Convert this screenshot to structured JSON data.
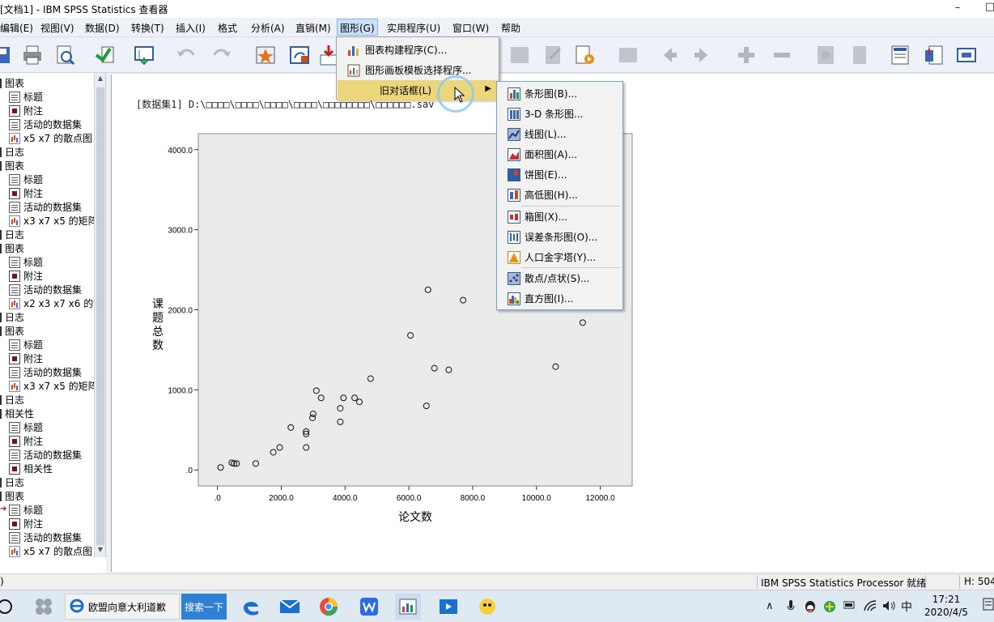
{
  "window": {
    "title": "[文档1] - IBM SPSS Statistics 查看器",
    "minimize_label": "–",
    "close_label": "□"
  },
  "menubar": {
    "items": [
      {
        "label": "编辑(E)"
      },
      {
        "label": "视图(V)"
      },
      {
        "label": "数据(D)"
      },
      {
        "label": "转换(T)"
      },
      {
        "label": "插入(I)"
      },
      {
        "label": "格式"
      },
      {
        "label": "分析(A)"
      },
      {
        "label": "直销(M)"
      },
      {
        "label": "图形(G)"
      },
      {
        "label": "实用程序(U)"
      },
      {
        "label": "窗口(W)"
      },
      {
        "label": "帮助"
      }
    ],
    "active": "图形(G)"
  },
  "graph_menu": {
    "items": [
      {
        "label": "图表构建程序(C)..."
      },
      {
        "label": "图形画板模板选择程序..."
      },
      {
        "label": "旧对话框(L)"
      }
    ],
    "highlighted": "旧对话框(L)"
  },
  "legacy_submenu": {
    "items": [
      {
        "label": "条形图(B)..."
      },
      {
        "label": "3-D 条形图..."
      },
      {
        "label": "线图(L)..."
      },
      {
        "label": "面积图(A)..."
      },
      {
        "label": "饼图(E)..."
      },
      {
        "label": "高低图(H)..."
      },
      {
        "label": "箱图(X)..."
      },
      {
        "label": "误差条形图(O)..."
      },
      {
        "label": "人口金字塔(Y)..."
      },
      {
        "label": "散点/点状(S)..."
      },
      {
        "label": "直方图(I)..."
      }
    ]
  },
  "nav_tree": {
    "rows": [
      {
        "label": "图表",
        "level": 0,
        "icon": "none"
      },
      {
        "label": "标题",
        "level": 1,
        "icon": "title-icon"
      },
      {
        "label": "附注",
        "level": 1,
        "icon": "notes-icon"
      },
      {
        "label": "活动的数据集",
        "level": 1,
        "icon": "dataset-icon"
      },
      {
        "label": "x5 x7 的散点图",
        "level": 1,
        "icon": "chart-icon"
      },
      {
        "label": "日志",
        "level": 0,
        "icon": "none"
      },
      {
        "label": "图表",
        "level": 0,
        "icon": "none"
      },
      {
        "label": "标题",
        "level": 1,
        "icon": "title-icon"
      },
      {
        "label": "附注",
        "level": 1,
        "icon": "notes-icon"
      },
      {
        "label": "活动的数据集",
        "level": 1,
        "icon": "dataset-icon"
      },
      {
        "label": "x3 x7 x5 的矩阵",
        "level": 1,
        "icon": "chart-icon"
      },
      {
        "label": "日志",
        "level": 0,
        "icon": "none"
      },
      {
        "label": "图表",
        "level": 0,
        "icon": "none"
      },
      {
        "label": "标题",
        "level": 1,
        "icon": "title-icon"
      },
      {
        "label": "附注",
        "level": 1,
        "icon": "notes-icon"
      },
      {
        "label": "活动的数据集",
        "level": 1,
        "icon": "dataset-icon"
      },
      {
        "label": "x2 x3 x7 x6 的散",
        "level": 1,
        "icon": "chart-icon"
      },
      {
        "label": "日志",
        "level": 0,
        "icon": "none"
      },
      {
        "label": "图表",
        "level": 0,
        "icon": "none"
      },
      {
        "label": "标题",
        "level": 1,
        "icon": "title-icon"
      },
      {
        "label": "附注",
        "level": 1,
        "icon": "notes-icon"
      },
      {
        "label": "活动的数据集",
        "level": 1,
        "icon": "dataset-icon"
      },
      {
        "label": "x3 x7 x5 的矩阵",
        "level": 1,
        "icon": "chart-icon"
      },
      {
        "label": "日志",
        "level": 0,
        "icon": "none"
      },
      {
        "label": "相关性",
        "level": 0,
        "icon": "none"
      },
      {
        "label": "标题",
        "level": 1,
        "icon": "title-icon"
      },
      {
        "label": "附注",
        "level": 1,
        "icon": "notes-icon"
      },
      {
        "label": "活动的数据集",
        "level": 1,
        "icon": "dataset-icon"
      },
      {
        "label": "相关性",
        "level": 1,
        "icon": "table-icon"
      },
      {
        "label": "日志",
        "level": 0,
        "icon": "none"
      },
      {
        "label": "图表",
        "level": 0,
        "icon": "none"
      },
      {
        "label": "标题",
        "level": 1,
        "icon": "title-icon",
        "selected": true
      },
      {
        "label": "附注",
        "level": 1,
        "icon": "notes-icon"
      },
      {
        "label": "活动的数据集",
        "level": 1,
        "icon": "dataset-icon"
      },
      {
        "label": "x5 x7 的散点图",
        "level": 1,
        "icon": "chart-icon"
      }
    ]
  },
  "output": {
    "file_path": "[数据集1] D:\\□□□□\\□□□□\\□□□□\\□□□□\\□□□□□□□□\\□□□□□□.sav"
  },
  "chart_data": {
    "type": "scatter",
    "title": "",
    "xlabel": "论文数",
    "ylabel": "课题总数",
    "xlim": [
      -600,
      13000
    ],
    "ylim": [
      -200,
      4200
    ],
    "x_ticks": [
      ".0",
      "2000.0",
      "4000.0",
      "6000.0",
      "8000.0",
      "10000.0",
      "12000.0"
    ],
    "x_tick_values": [
      0,
      2000,
      4000,
      6000,
      8000,
      10000,
      12000
    ],
    "y_ticks": [
      ".0",
      "1000.0",
      "2000.0",
      "3000.0",
      "4000.0"
    ],
    "y_tick_values": [
      0,
      1000,
      2000,
      3000,
      4000
    ],
    "marker": "open-circle",
    "plot_background": "#ebebeb",
    "points": [
      {
        "x": 100,
        "y": 30
      },
      {
        "x": 450,
        "y": 90
      },
      {
        "x": 520,
        "y": 80
      },
      {
        "x": 600,
        "y": 80
      },
      {
        "x": 1200,
        "y": 80
      },
      {
        "x": 1750,
        "y": 220
      },
      {
        "x": 1950,
        "y": 280
      },
      {
        "x": 2300,
        "y": 530
      },
      {
        "x": 2780,
        "y": 280
      },
      {
        "x": 2780,
        "y": 450
      },
      {
        "x": 2780,
        "y": 480
      },
      {
        "x": 2980,
        "y": 650
      },
      {
        "x": 3000,
        "y": 700
      },
      {
        "x": 3100,
        "y": 990
      },
      {
        "x": 3250,
        "y": 900
      },
      {
        "x": 3850,
        "y": 600
      },
      {
        "x": 3850,
        "y": 770
      },
      {
        "x": 3950,
        "y": 900
      },
      {
        "x": 4300,
        "y": 900
      },
      {
        "x": 4450,
        "y": 850
      },
      {
        "x": 4800,
        "y": 1140
      },
      {
        "x": 6050,
        "y": 1680
      },
      {
        "x": 6550,
        "y": 800
      },
      {
        "x": 6600,
        "y": 2250
      },
      {
        "x": 6800,
        "y": 1270
      },
      {
        "x": 7250,
        "y": 1250
      },
      {
        "x": 7700,
        "y": 2120
      },
      {
        "x": 10600,
        "y": 1290
      },
      {
        "x": 11450,
        "y": 1840
      }
    ]
  },
  "statusbar": {
    "left": ")",
    "processor": "IBM SPSS Statistics Processor 就绪",
    "h_label": "H: 504"
  },
  "taskbar": {
    "search_text": "欧盟向意大利道歉",
    "search_button": "搜索一下",
    "ime_label": "中",
    "time": "17:21",
    "date": "2020/4/5"
  }
}
